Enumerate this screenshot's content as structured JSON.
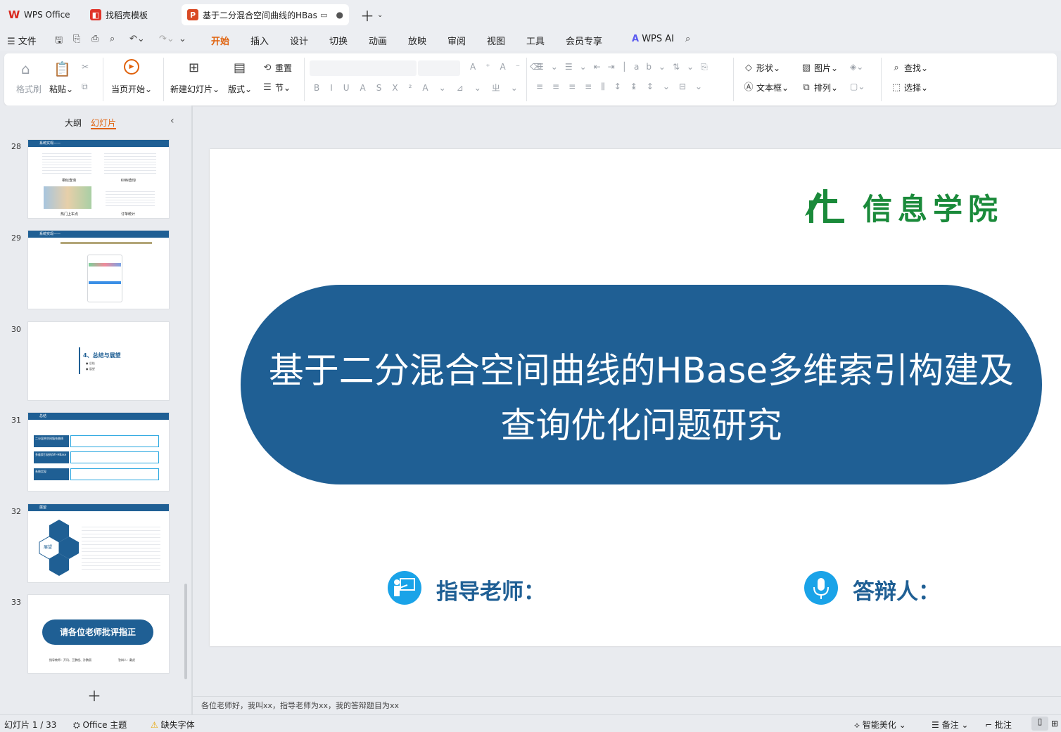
{
  "tabs": [
    {
      "label": "WPS Office"
    },
    {
      "label": "找稻壳模板"
    },
    {
      "label": "基于二分混合空间曲线的HBase"
    }
  ],
  "menu": {
    "file": "文件",
    "items": [
      "开始",
      "插入",
      "设计",
      "切换",
      "动画",
      "放映",
      "审阅",
      "视图",
      "工具",
      "会员专享"
    ],
    "active": "开始",
    "wps_ai": "WPS AI"
  },
  "ribbon": {
    "format_painter": "格式刷",
    "paste": "粘贴",
    "play_from_current": "当页开始",
    "new_slide": "新建幻灯片",
    "layout": "版式",
    "reset": "重置",
    "section": "节",
    "shape": "形状",
    "picture": "图片",
    "textbox": "文本框",
    "arrange": "排列",
    "find": "查找",
    "select": "选择"
  },
  "panel": {
    "outline_tab": "大纲",
    "slides_tab": "幻灯片",
    "active": "幻灯片"
  },
  "thumbnails": [
    {
      "num": "28",
      "header": "系统实现——",
      "caption1": "相似查询",
      "caption2": "KNN查询",
      "caption3": "热门上车点",
      "caption4": "订单统计"
    },
    {
      "num": "29",
      "header": "系统实现——"
    },
    {
      "num": "30",
      "title": "4、总结与展望",
      "bullet1": "总结",
      "bullet2": "展望"
    },
    {
      "num": "31",
      "header": "总结",
      "rows": [
        "二分混合空间填充曲线",
        "多维索引结构SFI-HBase",
        "系统实现"
      ]
    },
    {
      "num": "32",
      "header": "展望",
      "center": "展望"
    },
    {
      "num": "33",
      "pill": "请各位老师批评指正",
      "teacher": "指导教师：开讯、王鹏程、孙鹏丽",
      "defender": "答辩人：戴虎"
    }
  ],
  "slide": {
    "logo_text": "信息学院",
    "title_line1": "基于二分混合空间曲线的HBase多维索引构建及",
    "title_line2": "查询优化问题研究",
    "advisor_label": "指导老师：",
    "defender_label": "答辩人："
  },
  "notes": "各位老师好，我叫xx，指导老师为xx，我的答辩题目为xx",
  "status": {
    "slide_count": "幻灯片 1 / 33",
    "theme": "Office 主题",
    "missing_font": "缺失字体",
    "beautify": "智能美化",
    "notes": "备注",
    "comment": "批注"
  },
  "colors": {
    "accent": "#1f5f94",
    "icon_blue": "#1aa3e8",
    "menu_active": "#e0620d",
    "logo_green": "#1a8a3a"
  }
}
